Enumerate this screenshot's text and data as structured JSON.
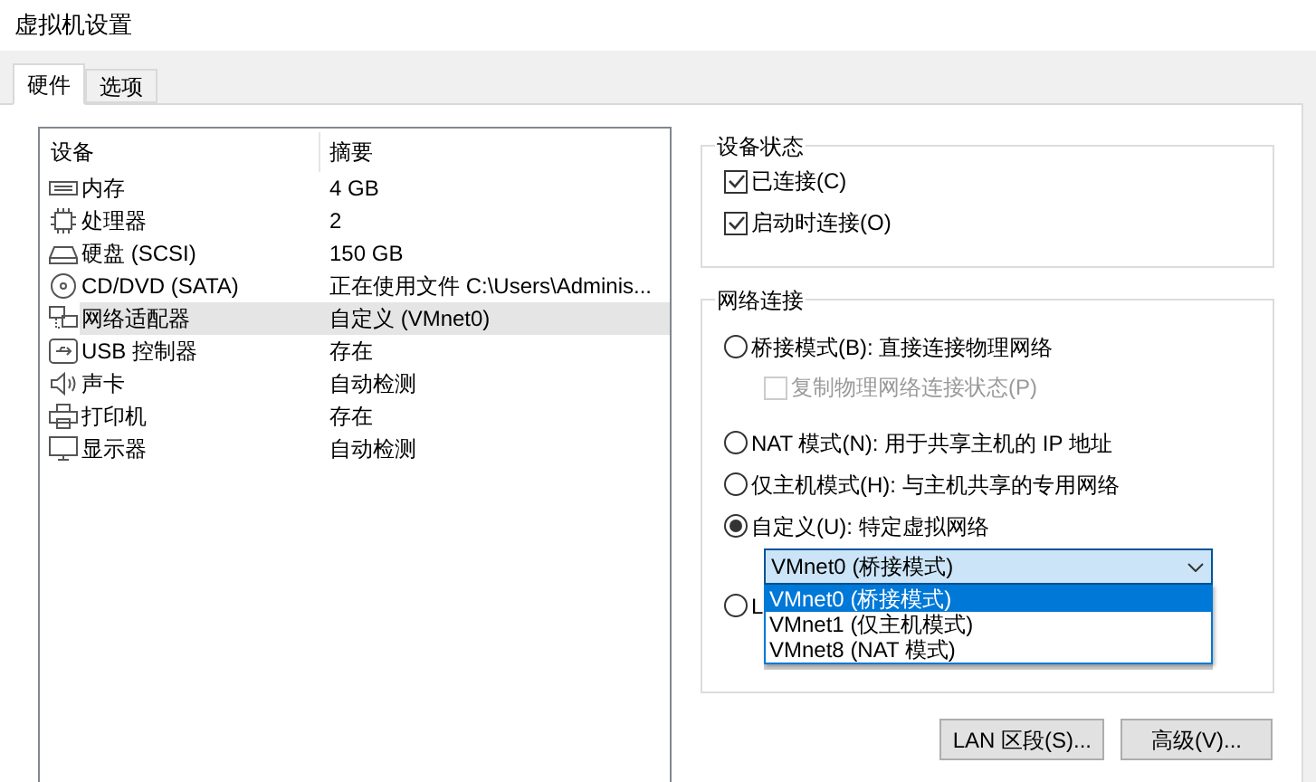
{
  "window": {
    "title": "虚拟机设置"
  },
  "tabs": [
    {
      "label": "硬件",
      "selected": true
    },
    {
      "label": "选项",
      "selected": false
    }
  ],
  "device_table": {
    "columns": [
      "设备",
      "摘要"
    ],
    "rows": [
      {
        "kind": "memory",
        "device": "内存",
        "summary": "4 GB",
        "selected": false
      },
      {
        "kind": "cpu",
        "device": "处理器",
        "summary": "2",
        "selected": false
      },
      {
        "kind": "disk",
        "device": "硬盘 (SCSI)",
        "summary": "150 GB",
        "selected": false
      },
      {
        "kind": "cd",
        "device": "CD/DVD (SATA)",
        "summary": "正在使用文件 C:\\Users\\Adminis...",
        "selected": false
      },
      {
        "kind": "network",
        "device": "网络适配器",
        "summary": "自定义 (VMnet0)",
        "selected": true
      },
      {
        "kind": "usb",
        "device": "USB 控制器",
        "summary": "存在",
        "selected": false
      },
      {
        "kind": "sound",
        "device": "声卡",
        "summary": "自动检测",
        "selected": false
      },
      {
        "kind": "printer",
        "device": "打印机",
        "summary": "存在",
        "selected": false
      },
      {
        "kind": "display",
        "device": "显示器",
        "summary": "自动检测",
        "selected": false
      }
    ]
  },
  "device_status": {
    "title": "设备状态",
    "options": [
      {
        "label": "已连接(C)",
        "checked": true
      },
      {
        "label": "启动时连接(O)",
        "checked": true
      }
    ]
  },
  "network": {
    "title": "网络连接",
    "options": [
      {
        "kind": "radio",
        "label": "桥接模式(B): 直接连接物理网络",
        "selected": false
      },
      {
        "kind": "checkbox",
        "label": "复制物理网络连接状态(P)",
        "checked": false,
        "disabled": true
      },
      {
        "kind": "radio",
        "label": "NAT 模式(N): 用于共享主机的 IP 地址",
        "selected": false
      },
      {
        "kind": "radio",
        "label": "仅主机模式(H): 与主机共享的专用网络",
        "selected": false
      },
      {
        "kind": "radio",
        "label": "自定义(U): 特定虚拟网络",
        "selected": true
      },
      {
        "kind": "select",
        "value": "VMnet0 (桥接模式)",
        "options": [
          {
            "label": "VMnet0 (桥接模式)",
            "selected": true
          },
          {
            "label": "VMnet1 (仅主机模式)",
            "selected": false
          },
          {
            "label": "VMnet8 (NAT 模式)",
            "selected": false
          }
        ]
      }
    ],
    "partly_hidden_option": {
      "label": "L",
      "selected": false
    }
  },
  "buttons": [
    "LAN 区段(S)...",
    "高级(V)..."
  ]
}
